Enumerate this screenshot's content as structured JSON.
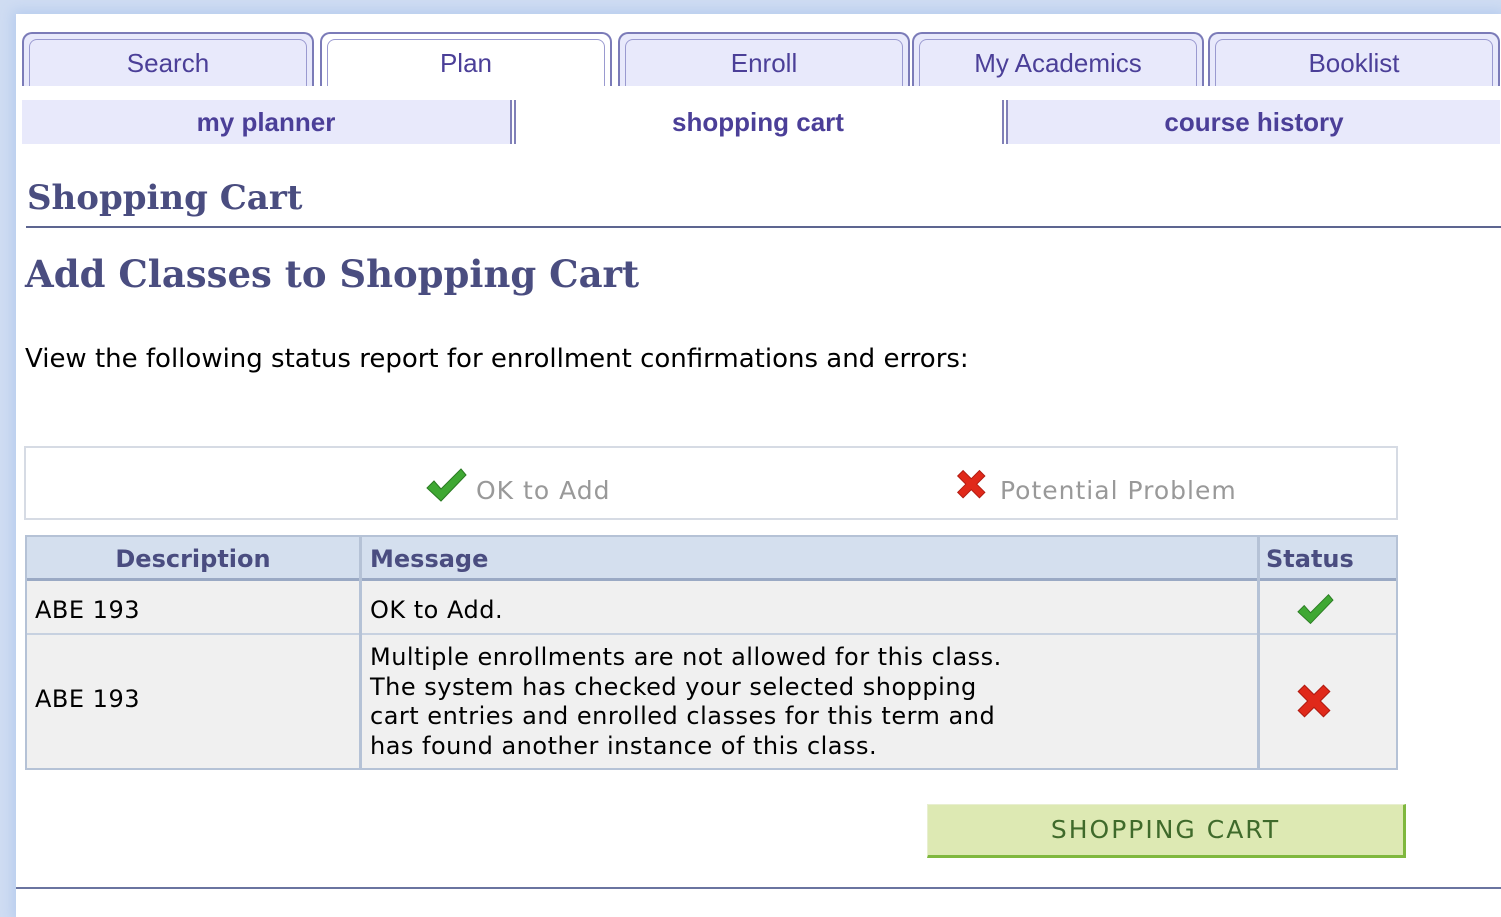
{
  "tabs": [
    "Search",
    "Plan",
    "Enroll",
    "My Academics",
    "Booklist"
  ],
  "active_tab": "Plan",
  "subtabs": [
    "my planner",
    "shopping cart",
    "course history"
  ],
  "active_subtab": "shopping cart",
  "page_title": "Shopping Cart",
  "section_title": "Add Classes to Shopping Cart",
  "intro_text": "View the following status report for enrollment confirmations and errors:",
  "legend": {
    "ok": {
      "icon": "checkmark-icon",
      "label": "OK to Add",
      "color": "#3fa833"
    },
    "problem": {
      "icon": "x-icon",
      "label": "Potential Problem",
      "color": "#e0291a"
    }
  },
  "table": {
    "headers": {
      "description": "Description",
      "message": "Message",
      "status": "Status"
    },
    "rows": [
      {
        "description": "ABE  193",
        "message": [
          "OK to Add."
        ],
        "status": "ok"
      },
      {
        "description": "ABE  193",
        "message": [
          "Multiple enrollments are not allowed for this class.",
          "The system has checked your selected shopping",
          "cart entries and enrolled classes for this term and",
          "has found another instance of this class."
        ],
        "status": "problem"
      }
    ]
  },
  "button_label": "SHOPPING CART"
}
